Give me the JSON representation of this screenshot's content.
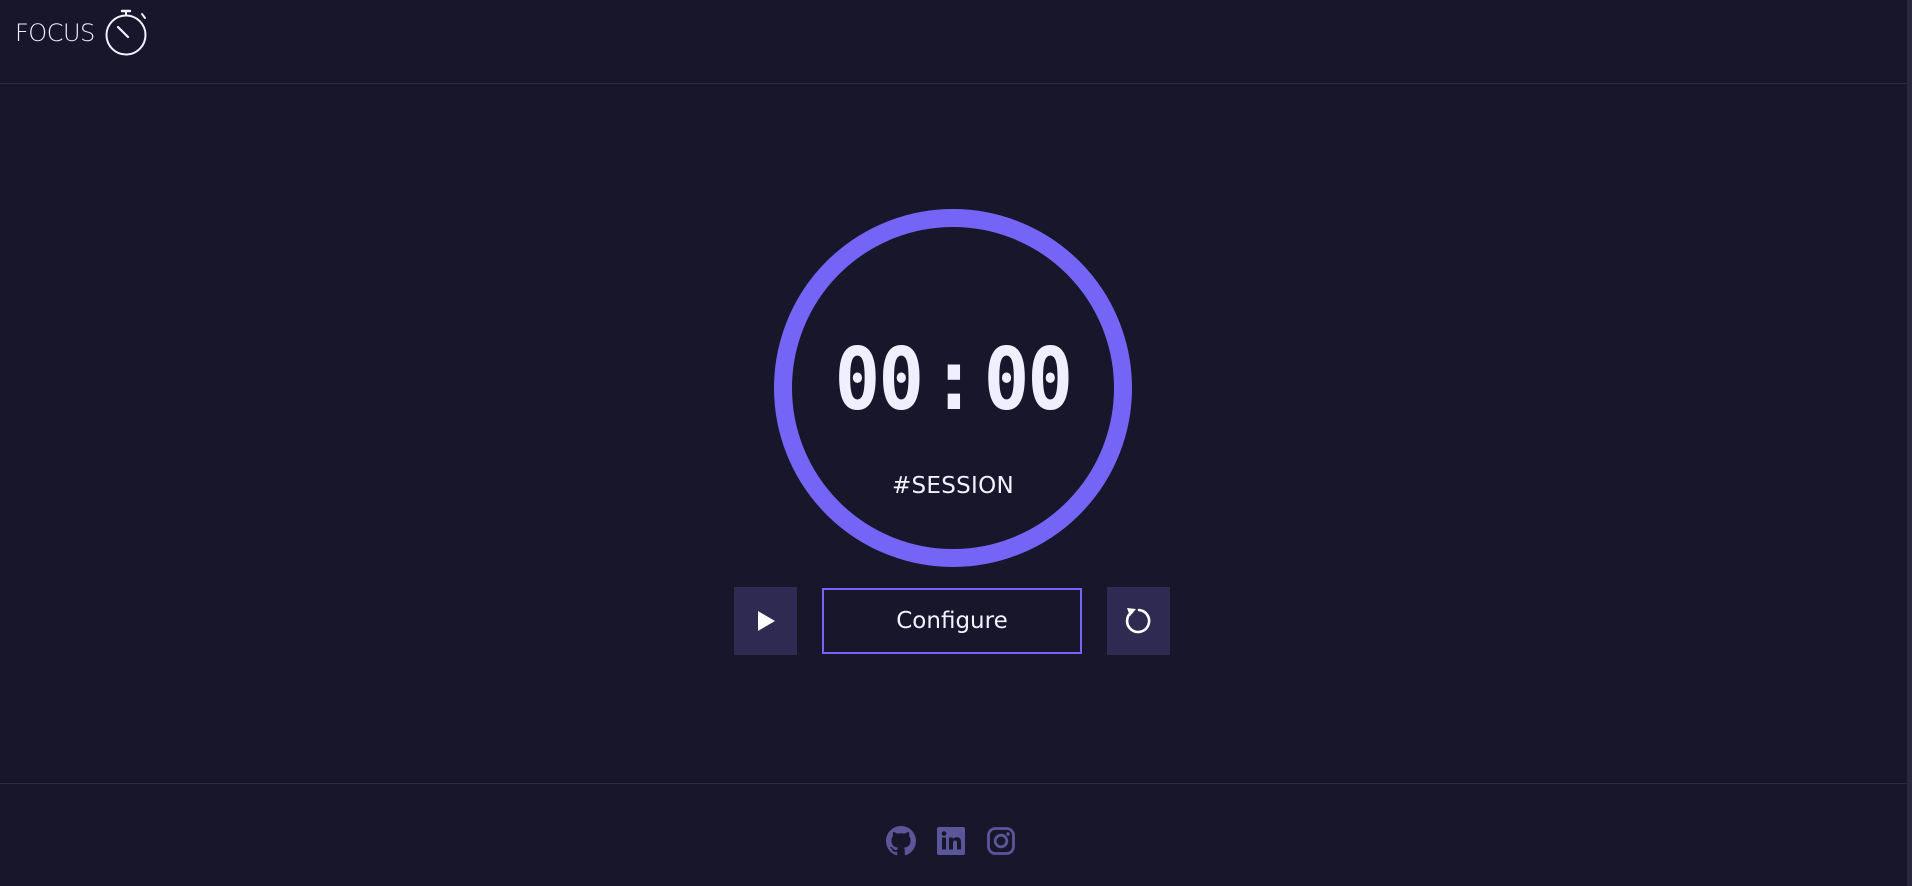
{
  "header": {
    "brand": "FOCUS",
    "brand_icon": "stopwatch-icon"
  },
  "timer": {
    "minutes": "00",
    "separator": ":",
    "seconds": "00",
    "label": "#SESSION",
    "ring_color": "#7565f7"
  },
  "controls": {
    "play_icon": "play-icon",
    "configure_label": "Configure",
    "reset_icon": "reset-icon"
  },
  "footer": {
    "links": [
      {
        "icon": "github-icon"
      },
      {
        "icon": "linkedin-icon"
      },
      {
        "icon": "instagram-icon"
      }
    ]
  },
  "colors": {
    "background": "#18162b",
    "accent": "#7565f7",
    "button_bg": "#2e2a52",
    "social_icon": "#5a5699"
  }
}
